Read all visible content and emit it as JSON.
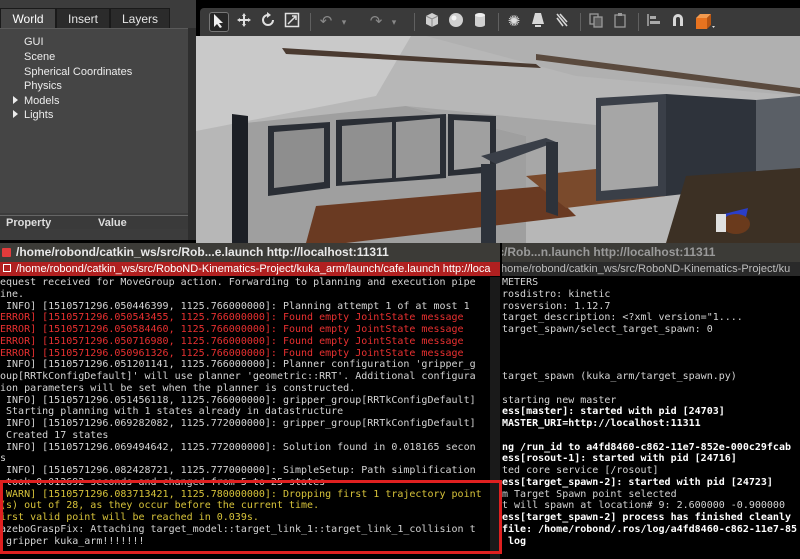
{
  "gazebo": {
    "tabs": [
      "World",
      "Insert",
      "Layers"
    ],
    "tree_items": [
      "GUI",
      "Scene",
      "Spherical Coordinates",
      "Physics",
      "Models",
      "Lights"
    ],
    "property_header": {
      "property": "Property",
      "value": "Value"
    },
    "splitter_glyph": "....",
    "toolbar_icons": [
      "select-arrow-icon",
      "translate-icon",
      "rotate-icon",
      "scale-icon",
      "undo-icon",
      "undo-dropdown-icon",
      "redo-icon",
      "redo-dropdown-icon",
      "box-icon",
      "sphere-icon",
      "cylinder-icon",
      "point-light-icon",
      "spot-light-icon",
      "directional-light-icon",
      "copy-icon",
      "paste-icon",
      "align-icon",
      "snap-icon",
      "change-view-icon"
    ]
  },
  "terminal_left": {
    "window_title": "/home/robond/catkin_ws/src/Rob...e.launch http://localhost:11311",
    "tab_title": "/home/robond/catkin_ws/src/RoboND-Kinematics-Project/kuka_arm/launch/cafe.launch http://loca",
    "lines": [
      {
        "text": "equest received for MoveGroup action. Forwarding to planning and execution pipe",
        "color": "#d4d4d4"
      },
      {
        "text": "ine.",
        "color": "#d4d4d4"
      },
      {
        "text": " INFO] [1510571296.050446399, 1125.766000000]: Planning attempt 1 of at most 1",
        "color": "#d4d4d4"
      },
      {
        "text": "ERROR] [1510571296.050543455, 1125.766000000]: Found empty JointState message",
        "color": "#e83030"
      },
      {
        "text": "ERROR] [1510571296.050584460, 1125.766000000]: Found empty JointState message",
        "color": "#e83030"
      },
      {
        "text": "ERROR] [1510571296.050716980, 1125.766000000]: Found empty JointState message",
        "color": "#e83030"
      },
      {
        "text": "ERROR] [1510571296.050961326, 1125.766000000]: Found empty JointState message",
        "color": "#e83030"
      },
      {
        "text": " INFO] [1510571296.051201141, 1125.766000000]: Planner configuration 'gripper_g",
        "color": "#d4d4d4"
      },
      {
        "text": "oup[RRTkConfigDefault]' will use planner 'geometric::RRT'. Additional configura",
        "color": "#d4d4d4"
      },
      {
        "text": "ion parameters will be set when the planner is constructed.",
        "color": "#d4d4d4"
      },
      {
        "text": " INFO] [1510571296.051456118, 1125.766000000]: gripper_group[RRTkConfigDefault]",
        "color": "#d4d4d4"
      },
      {
        "text": " Starting planning with 1 states already in datastructure",
        "color": "#d4d4d4"
      },
      {
        "text": " INFO] [1510571296.069282082, 1125.772000000]: gripper_group[RRTkConfigDefault]",
        "color": "#d4d4d4"
      },
      {
        "text": " Created 17 states",
        "color": "#d4d4d4"
      },
      {
        "text": " INFO] [1510571296.069494642, 1125.772000000]: Solution found in 0.018165 secon",
        "color": "#d4d4d4"
      },
      {
        "text": "s",
        "color": "#d4d4d4"
      },
      {
        "text": " INFO] [1510571296.082428721, 1125.777000000]: SimpleSetup: Path simplification",
        "color": "#d4d4d4"
      },
      {
        "text": " took 0.012692 seconds and changed from 5 to 25 states",
        "color": "#d4d4d4"
      },
      {
        "text": " WARN] [1510571296.083713421, 1125.780000000]: Dropping first 1 trajectory point",
        "color": "#d6c23a"
      },
      {
        "text": "(s) out of 28, as they occur before the current time.",
        "color": "#d6c23a"
      },
      {
        "text": "irst valid point will be reached in 0.039s.",
        "color": "#d6c23a"
      },
      {
        "text": "azeboGraspFix: Attaching target_model::target_link_1::target_link_1_collision t",
        "color": "#d4d4d4"
      },
      {
        "text": " gripper kuka_arm!!!!!!!",
        "color": "#d4d4d4"
      }
    ]
  },
  "terminal_right": {
    "window_title": "/home/robond/catkin_ws/src/Rob...n.launch http://localhost:11311",
    "tab_title": "/home/robond/catkin_ws/src/RoboND-Kinematics-Project/ku",
    "lines": [
      {
        "text": "METERS",
        "color": "#d4d4d4",
        "bold": false
      },
      {
        "text": "rosdistro: kinetic",
        "color": "#d4d4d4",
        "bold": false
      },
      {
        "text": "rosversion: 1.12.7",
        "color": "#d4d4d4",
        "bold": false
      },
      {
        "text": "target_description: <?xml version=\"1....",
        "color": "#d4d4d4",
        "bold": false
      },
      {
        "text": "target_spawn/select_target_spawn: 0",
        "color": "#d4d4d4",
        "bold": false
      },
      {
        "text": "",
        "color": "#d4d4d4",
        "bold": false
      },
      {
        "text": "",
        "color": "#d4d4d4",
        "bold": false
      },
      {
        "text": "",
        "color": "#d4d4d4",
        "bold": false
      },
      {
        "text": "target_spawn (kuka_arm/target_spawn.py)",
        "color": "#d4d4d4",
        "bold": false
      },
      {
        "text": "",
        "color": "#d4d4d4",
        "bold": false
      },
      {
        "text": "starting new master",
        "color": "#d4d4d4",
        "bold": false
      },
      {
        "text": "ess[master]: started with pid [24703]",
        "color": "#ffffff",
        "bold": true
      },
      {
        "text": "MASTER_URI=http://localhost:11311",
        "color": "#ffffff",
        "bold": true
      },
      {
        "text": "",
        "color": "#d4d4d4",
        "bold": false
      },
      {
        "text": "ng /run_id to a4fd8460-c862-11e7-852e-000c29fcab",
        "color": "#ffffff",
        "bold": true
      },
      {
        "text": "ess[rosout-1]: started with pid [24716]",
        "color": "#ffffff",
        "bold": true
      },
      {
        "text": "ted core service [/rosout]",
        "color": "#d4d4d4",
        "bold": false
      },
      {
        "text": "ess[target_spawn-2]: started with pid [24723]",
        "color": "#ffffff",
        "bold": true
      },
      {
        "text": "m Target Spawn point selected",
        "color": "#d4d4d4",
        "bold": false
      },
      {
        "text": "t will spawn at location# 9: 2.600000 -0.900000",
        "color": "#d4d4d4",
        "bold": false
      },
      {
        "text": "ess[target_spawn-2] process has finished cleanly",
        "color": "#ffffff",
        "bold": true
      },
      {
        "text": "file: /home/robond/.ros/log/a4fd8460-c862-11e7-85",
        "color": "#ffffff",
        "bold": true
      },
      {
        "text": " log",
        "color": "#ffffff",
        "bold": true
      }
    ]
  },
  "colors": {
    "titlebar_bg": "#3c3b37",
    "tab_active_bg": "#b02020",
    "highlight_border": "#e02020",
    "terminal_bg": "#000000"
  }
}
